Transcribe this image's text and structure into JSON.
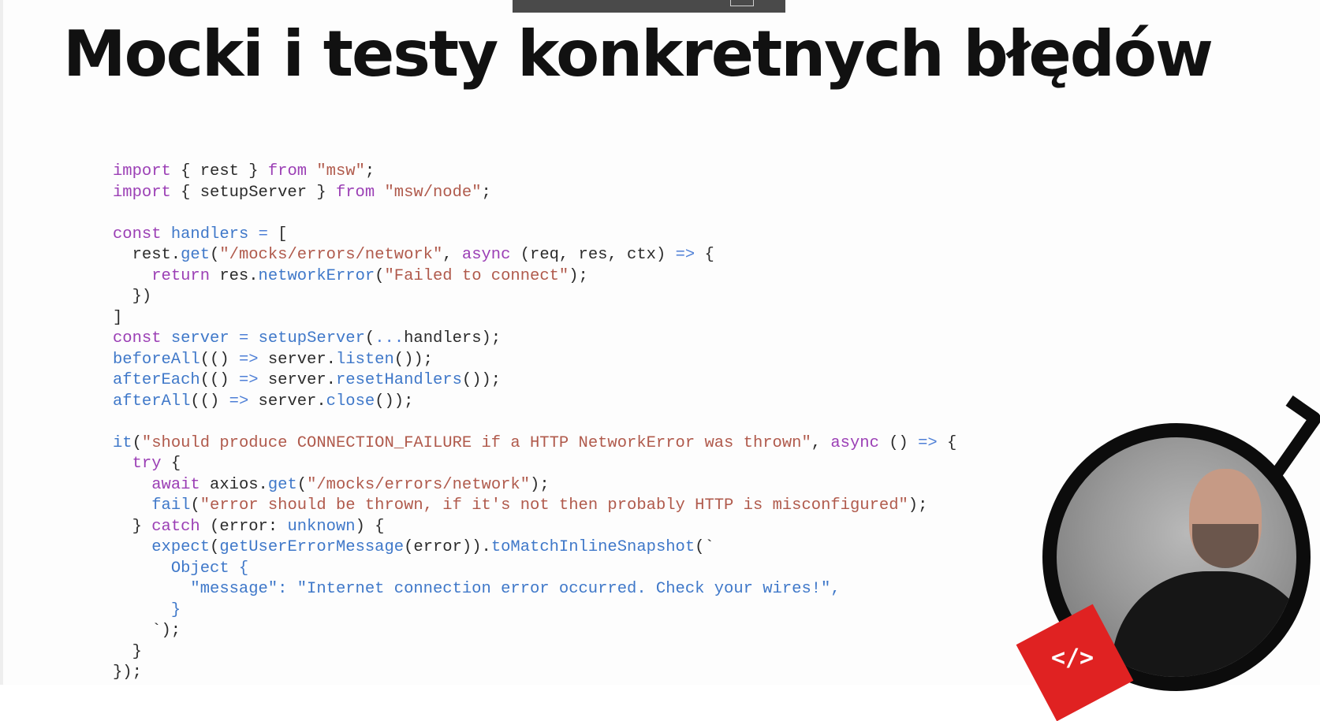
{
  "slide": {
    "title": "Mocki i testy konkretnych błędów"
  },
  "badge": {
    "label": "</>"
  },
  "colors": {
    "keyword": "#9b3fb5",
    "string": "#b05a4c",
    "identifier": "#3f78c9",
    "text": "#2b2b2b",
    "badge": "#e02222"
  }
}
